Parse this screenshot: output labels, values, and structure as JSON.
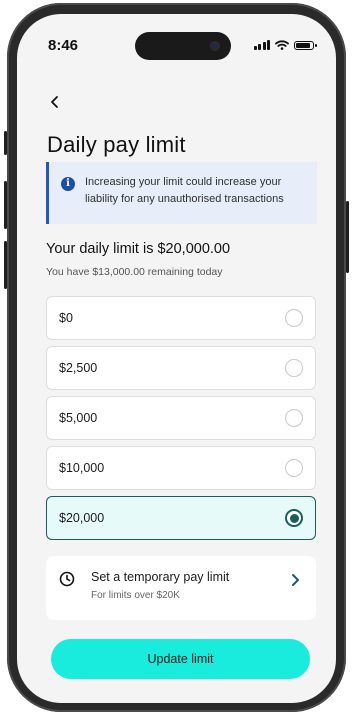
{
  "status_bar": {
    "time": "8:46"
  },
  "page": {
    "title": "Daily pay limit"
  },
  "notice": {
    "text": "Increasing your limit could increase your liability for any unauthorised transactions"
  },
  "limit": {
    "title": "Your daily limit is $20,000.00",
    "remaining": "You have $13,000.00 remaining today"
  },
  "options": [
    {
      "label": "$0",
      "selected": false
    },
    {
      "label": "$2,500",
      "selected": false
    },
    {
      "label": "$5,000",
      "selected": false
    },
    {
      "label": "$10,000",
      "selected": false
    },
    {
      "label": "$20,000",
      "selected": true
    }
  ],
  "temporary": {
    "title": "Set a temporary pay limit",
    "subtitle": "For limits over $20K"
  },
  "actions": {
    "update_label": "Update limit"
  },
  "colors": {
    "accent": "#19ecdc",
    "selected_border": "#1a5d5b",
    "notice_bar": "#1f5ab8"
  },
  "icons": [
    "back-arrow-icon",
    "info-icon",
    "clock-icon",
    "chevron-right-icon",
    "signal-icon",
    "wifi-icon",
    "battery-icon"
  ]
}
